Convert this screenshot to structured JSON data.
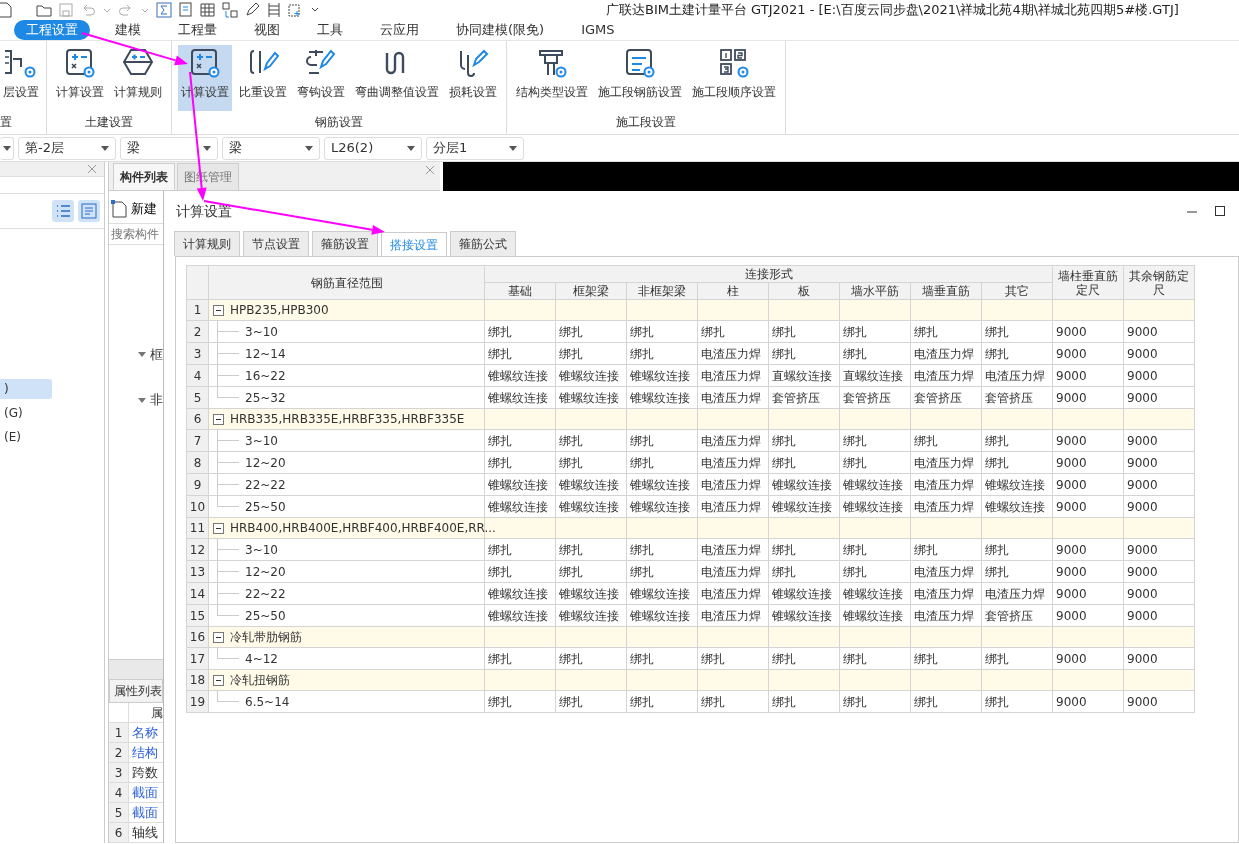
{
  "title_bar": {
    "title": "广联达BIM土建计量平台 GTJ2021 - [E:\\百度云同步盘\\2021\\祥城北苑4期\\祥城北苑四期5#楼.GTJ]"
  },
  "menu": [
    {
      "label": "工程设置",
      "selected": true
    },
    {
      "label": "建模",
      "selected": false
    },
    {
      "label": "工程量",
      "selected": false
    },
    {
      "label": "视图",
      "selected": false
    },
    {
      "label": "工具",
      "selected": false
    },
    {
      "label": "云应用",
      "selected": false
    },
    {
      "label": "协同建模(限免)",
      "selected": false
    },
    {
      "label": "IGMS",
      "selected": false
    }
  ],
  "ribbon": {
    "groups": [
      {
        "label": "置",
        "buttons": [
          {
            "label": "层设置",
            "selected": false
          }
        ]
      },
      {
        "label": "土建设置",
        "buttons": [
          {
            "label": "计算设置",
            "selected": false
          },
          {
            "label": "计算规则",
            "selected": false
          }
        ]
      },
      {
        "label": "钢筋设置",
        "buttons": [
          {
            "label": "计算设置",
            "selected": true
          },
          {
            "label": "比重设置",
            "selected": false
          },
          {
            "label": "弯钩设置",
            "selected": false
          },
          {
            "label": "弯曲调整值设置",
            "selected": false
          },
          {
            "label": "损耗设置",
            "selected": false
          }
        ]
      },
      {
        "label": "施工段设置",
        "buttons": [
          {
            "label": "结构类型设置",
            "selected": false
          },
          {
            "label": "施工段钢筋设置",
            "selected": false
          },
          {
            "label": "施工段顺序设置",
            "selected": false
          }
        ]
      }
    ]
  },
  "selectors": [
    {
      "value": "第-2层"
    },
    {
      "value": "梁"
    },
    {
      "value": "梁"
    },
    {
      "value": "L26(2)"
    },
    {
      "value": "分层1"
    }
  ],
  "left_panel": {
    "items": [
      {
        "label": ")",
        "selected": true
      },
      {
        "label": "(G)",
        "selected": false
      },
      {
        "label": "(E)",
        "selected": false
      }
    ]
  },
  "component_panel": {
    "tabs": [
      {
        "label": "构件列表",
        "selected": true
      },
      {
        "label": "图纸管理",
        "selected": false
      }
    ],
    "new_button": "新建",
    "search": {
      "placeholder": "搜索构件"
    },
    "tree": [
      {
        "label": "框",
        "expanded": true
      },
      {
        "label": "非",
        "expanded": true
      }
    ],
    "properties": {
      "title": "属性列表",
      "header": "属",
      "rows": [
        {
          "num": "1",
          "name": "名称",
          "public": true
        },
        {
          "num": "2",
          "name": "结构",
          "public": true
        },
        {
          "num": "3",
          "name": "跨数",
          "public": false
        },
        {
          "num": "4",
          "name": "截面",
          "public": true
        },
        {
          "num": "5",
          "name": "截面",
          "public": true
        },
        {
          "num": "6",
          "name": "轴线",
          "public": false
        }
      ]
    }
  },
  "dialog": {
    "title": "计算设置",
    "tabs": [
      {
        "label": "计算规则",
        "selected": false
      },
      {
        "label": "节点设置",
        "selected": false
      },
      {
        "label": "箍筋设置",
        "selected": false
      },
      {
        "label": "搭接设置",
        "selected": true
      },
      {
        "label": "箍筋公式",
        "selected": false
      }
    ],
    "table": {
      "columns": {
        "range": "钢筋直径范围",
        "connection": "连接形式",
        "connection_types": [
          "基础",
          "框架梁",
          "非框架梁",
          "柱",
          "板",
          "墙水平筋",
          "墙垂直筋",
          "其它"
        ],
        "extra": [
          "墙柱垂直筋定尺",
          "其余钢筋定尺"
        ]
      },
      "groups": [
        {
          "num": "1",
          "label": "HPB235,HPB300",
          "expanded": true,
          "children": [
            {
              "num": "2",
              "label": "3~10",
              "cells": [
                "绑扎",
                "绑扎",
                "绑扎",
                "绑扎",
                "绑扎",
                "绑扎",
                "绑扎",
                "绑扎",
                "9000",
                "9000"
              ]
            },
            {
              "num": "3",
              "label": "12~14",
              "cells": [
                "绑扎",
                "绑扎",
                "绑扎",
                "电渣压力焊",
                "绑扎",
                "绑扎",
                "电渣压力焊",
                "绑扎",
                "9000",
                "9000"
              ]
            },
            {
              "num": "4",
              "label": "16~22",
              "cells": [
                "锥螺纹连接",
                "锥螺纹连接",
                "锥螺纹连接",
                "电渣压力焊",
                "直螺纹连接",
                "直螺纹连接",
                "电渣压力焊",
                "电渣压力焊",
                "9000",
                "9000"
              ]
            },
            {
              "num": "5",
              "label": "25~32",
              "cells": [
                "锥螺纹连接",
                "锥螺纹连接",
                "锥螺纹连接",
                "电渣压力焊",
                "套管挤压",
                "套管挤压",
                "套管挤压",
                "套管挤压",
                "9000",
                "9000"
              ]
            }
          ]
        },
        {
          "num": "6",
          "label": "HRB335,HRB335E,HRBF335,HRBF335E",
          "expanded": true,
          "children": [
            {
              "num": "7",
              "label": "3~10",
              "cells": [
                "绑扎",
                "绑扎",
                "绑扎",
                "电渣压力焊",
                "绑扎",
                "绑扎",
                "绑扎",
                "绑扎",
                "9000",
                "9000"
              ]
            },
            {
              "num": "8",
              "label": "12~20",
              "cells": [
                "绑扎",
                "绑扎",
                "绑扎",
                "电渣压力焊",
                "绑扎",
                "绑扎",
                "电渣压力焊",
                "绑扎",
                "9000",
                "9000"
              ]
            },
            {
              "num": "9",
              "label": "22~22",
              "cells": [
                "锥螺纹连接",
                "锥螺纹连接",
                "锥螺纹连接",
                "电渣压力焊",
                "锥螺纹连接",
                "锥螺纹连接",
                "电渣压力焊",
                "锥螺纹连接",
                "9000",
                "9000"
              ]
            },
            {
              "num": "10",
              "label": "25~50",
              "cells": [
                "锥螺纹连接",
                "锥螺纹连接",
                "锥螺纹连接",
                "电渣压力焊",
                "锥螺纹连接",
                "锥螺纹连接",
                "电渣压力焊",
                "锥螺纹连接",
                "9000",
                "9000"
              ]
            }
          ]
        },
        {
          "num": "11",
          "label": "HRB400,HRB400E,HRBF400,HRBF400E,RR...",
          "expanded": true,
          "children": [
            {
              "num": "12",
              "label": "3~10",
              "cells": [
                "绑扎",
                "绑扎",
                "绑扎",
                "电渣压力焊",
                "绑扎",
                "绑扎",
                "绑扎",
                "绑扎",
                "9000",
                "9000"
              ]
            },
            {
              "num": "13",
              "label": "12~20",
              "cells": [
                "绑扎",
                "绑扎",
                "绑扎",
                "电渣压力焊",
                "绑扎",
                "绑扎",
                "电渣压力焊",
                "绑扎",
                "9000",
                "9000"
              ]
            },
            {
              "num": "14",
              "label": "22~22",
              "cells": [
                "锥螺纹连接",
                "锥螺纹连接",
                "锥螺纹连接",
                "电渣压力焊",
                "锥螺纹连接",
                "锥螺纹连接",
                "电渣压力焊",
                "电渣压力焊",
                "9000",
                "9000"
              ]
            },
            {
              "num": "15",
              "label": "25~50",
              "cells": [
                "锥螺纹连接",
                "锥螺纹连接",
                "锥螺纹连接",
                "电渣压力焊",
                "锥螺纹连接",
                "锥螺纹连接",
                "电渣压力焊",
                "套管挤压",
                "9000",
                "9000"
              ]
            }
          ]
        },
        {
          "num": "16",
          "label": "冷轧带肋钢筋",
          "expanded": true,
          "children": [
            {
              "num": "17",
              "label": "4~12",
              "cells": [
                "绑扎",
                "绑扎",
                "绑扎",
                "绑扎",
                "绑扎",
                "绑扎",
                "绑扎",
                "绑扎",
                "9000",
                "9000"
              ]
            }
          ]
        },
        {
          "num": "18",
          "label": "冷轧扭钢筋",
          "expanded": true,
          "children": [
            {
              "num": "19",
              "label": "6.5~14",
              "cells": [
                "绑扎",
                "绑扎",
                "绑扎",
                "绑扎",
                "绑扎",
                "绑扎",
                "绑扎",
                "绑扎",
                "9000",
                "9000"
              ]
            }
          ]
        }
      ]
    }
  }
}
